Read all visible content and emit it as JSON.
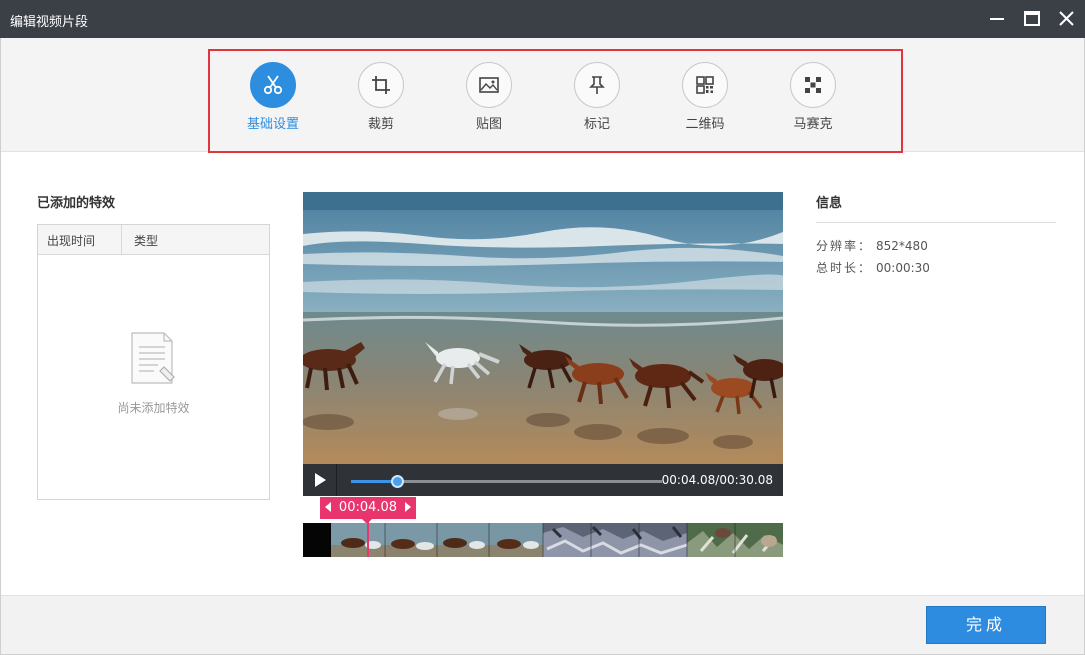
{
  "window": {
    "title": "编辑视频片段"
  },
  "toolbar": {
    "tools": [
      {
        "label": "基础设置",
        "icon": "scissors-icon",
        "active": true
      },
      {
        "label": "裁剪",
        "icon": "crop-icon",
        "active": false
      },
      {
        "label": "贴图",
        "icon": "image-icon",
        "active": false
      },
      {
        "label": "标记",
        "icon": "pin-icon",
        "active": false
      },
      {
        "label": "二维码",
        "icon": "qrcode-icon",
        "active": false
      },
      {
        "label": "马赛克",
        "icon": "mosaic-icon",
        "active": false
      }
    ]
  },
  "effects": {
    "title": "已添加的特效",
    "columns": [
      "出现时间",
      "类型"
    ],
    "empty_text": "尚未添加特效"
  },
  "player": {
    "current_time": "00:04.08",
    "time_display": "00:04.08/00:30.08",
    "progress_fraction": 0.148
  },
  "timeline": {
    "marker_time": "00:04.08"
  },
  "info": {
    "title": "信息",
    "resolution_label": "分辨率：",
    "resolution_value": "852*480",
    "duration_label": "总时长：",
    "duration_value": "00:00:30"
  },
  "footer": {
    "done_label": "完成"
  },
  "colors": {
    "accent": "#2d8ee0",
    "marker": "#e8356d",
    "highlight_border": "#e0353c",
    "titlebar": "#3b3f46"
  }
}
